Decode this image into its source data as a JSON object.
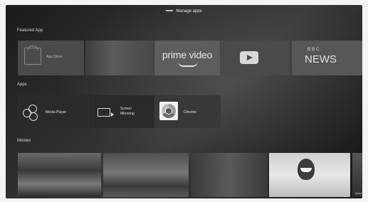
{
  "header": {
    "title": "Manage apps"
  },
  "sections": {
    "favorites": "Featured App",
    "apps": "Apps",
    "movies": "Movies"
  },
  "favorites": [
    {
      "label": "App Store",
      "icon": "shopping-bag-icon"
    },
    {
      "label": "",
      "icon": "image-tile"
    },
    {
      "label": "prime video",
      "icon": "prime-video-logo"
    },
    {
      "label": "",
      "icon": "youtube-play-icon"
    },
    {
      "label_top": "BBC",
      "label": "NEWS",
      "icon": "bbc-news-logo"
    }
  ],
  "apps": [
    {
      "label": "Media Player",
      "icon": "media-player-icon"
    },
    {
      "label_line1": "Screen",
      "label_line2": "Mirroring",
      "icon": "screen-mirroring-icon"
    },
    {
      "label": "Chrome",
      "icon": "chrome-icon"
    }
  ],
  "movies": [
    {
      "caption": ""
    },
    {
      "caption": ""
    },
    {
      "caption": ""
    },
    {
      "caption": ""
    },
    {
      "caption": "Ques"
    }
  ]
}
